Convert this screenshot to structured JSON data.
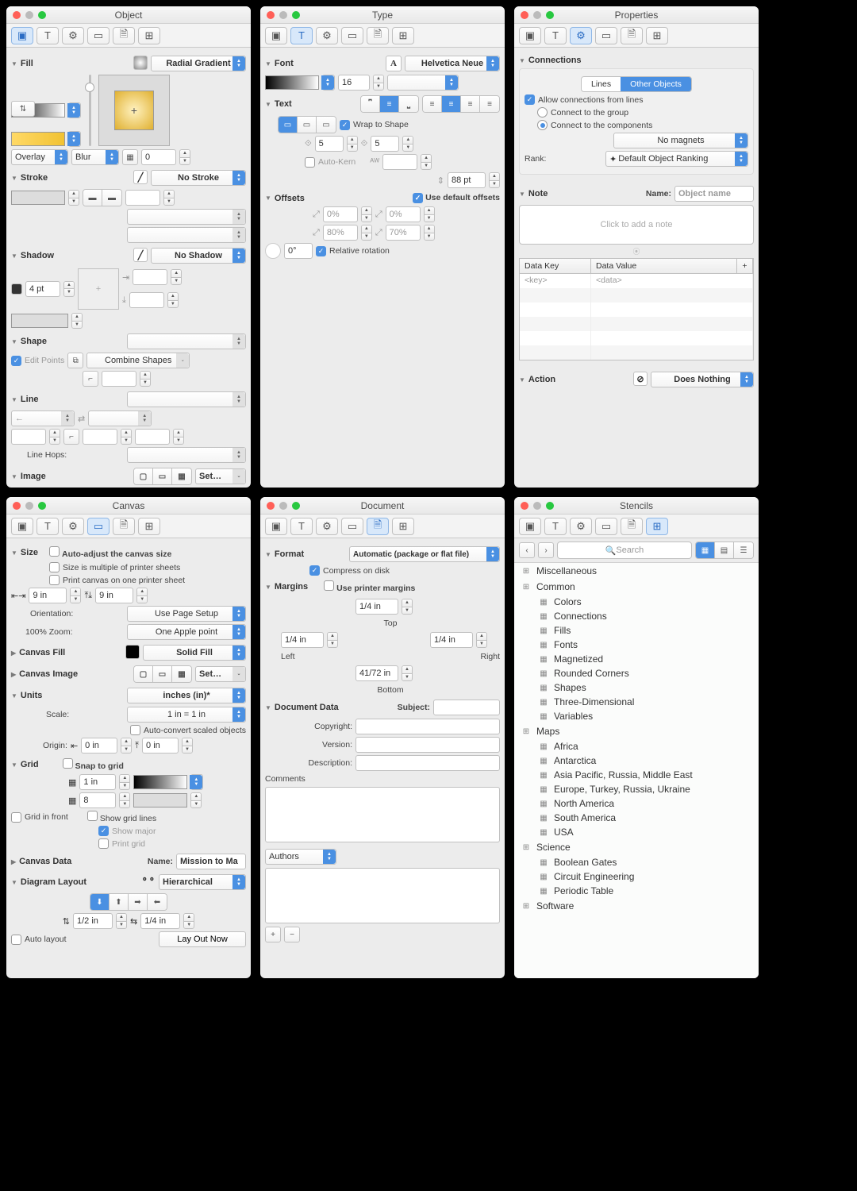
{
  "panels": {
    "object": {
      "title": "Object",
      "fill": {
        "label": "Fill",
        "type": "Radial Gradient",
        "blend": "Overlay",
        "blur": "Blur",
        "blur_val": "0"
      },
      "stroke": {
        "label": "Stroke",
        "type": "No Stroke"
      },
      "shadow": {
        "label": "Shadow",
        "type": "No Shadow",
        "size": "4 pt"
      },
      "shape": {
        "label": "Shape",
        "edit": "Edit Points",
        "combine": "Combine Shapes"
      },
      "line": {
        "label": "Line",
        "hops": "Line Hops:"
      },
      "image": {
        "label": "Image",
        "set": "Set…"
      }
    },
    "type": {
      "title": "Type",
      "font": {
        "label": "Font",
        "family": "Helvetica Neue",
        "size": "16"
      },
      "text": {
        "label": "Text",
        "wrap": "Wrap to Shape",
        "kern": "Auto-Kern",
        "inset1": "5",
        "inset2": "5",
        "lineheight": "88 pt"
      },
      "offsets": {
        "label": "Offsets",
        "default": "Use default offsets",
        "v1": "0%",
        "v2": "0%",
        "v3": "80%",
        "v4": "70%",
        "rot": "0°",
        "relrot": "Relative rotation"
      }
    },
    "properties": {
      "title": "Properties",
      "connections": {
        "label": "Connections",
        "tab1": "Lines",
        "tab2": "Other Objects",
        "allow": "Allow connections from lines",
        "opt1": "Connect to the group",
        "opt2": "Connect to the components",
        "magnets": "No magnets",
        "rank": "Rank:",
        "ranking": "Default Object Ranking"
      },
      "note": {
        "label": "Note",
        "name": "Name:",
        "placeholder": "Object name",
        "noteplaceholder": "Click to add a note",
        "key": "Data Key",
        "value": "Data Value",
        "keyph": "<key>",
        "valph": "<data>"
      },
      "action": {
        "label": "Action",
        "value": "Does Nothing"
      }
    },
    "canvas": {
      "title": "Canvas",
      "size": {
        "label": "Size",
        "auto": "Auto-adjust the canvas size",
        "multiple": "Size is multiple of printer sheets",
        "one": "Print canvas on one printer sheet",
        "w": "9 in",
        "h": "9 in",
        "orient": "Orientation:",
        "orientval": "Use Page Setup",
        "zoom": "100% Zoom:",
        "zoomval": "One Apple point"
      },
      "canvasfill": {
        "label": "Canvas Fill",
        "value": "Solid Fill"
      },
      "canvasimage": {
        "label": "Canvas Image",
        "set": "Set…"
      },
      "units": {
        "label": "Units",
        "value": "inches (in)*",
        "scale": "Scale:",
        "scaleval": "1 in = 1 in",
        "autoconv": "Auto-convert scaled objects",
        "origin": "Origin:",
        "ox": "0 in",
        "oy": "0 in"
      },
      "grid": {
        "label": "Grid",
        "snap": "Snap to grid",
        "spacing": "1 in",
        "sub": "8",
        "front": "Grid in front",
        "show": "Show grid lines",
        "major": "Show major",
        "print": "Print grid"
      },
      "canvasdata": {
        "label": "Canvas Data",
        "name": "Name:",
        "nameval": "Mission to Ma"
      },
      "diagram": {
        "label": "Diagram Layout",
        "value": "Hierarchical",
        "v1": "1/2 in",
        "v2": "1/4 in",
        "auto": "Auto layout",
        "btn": "Lay Out Now"
      }
    },
    "document": {
      "title": "Document",
      "format": {
        "label": "Format",
        "value": "Automatic (package or flat file)",
        "compress": "Compress on disk"
      },
      "margins": {
        "label": "Margins",
        "printer": "Use printer margins",
        "top": "1/4 in",
        "toplabel": "Top",
        "left": "1/4 in",
        "leftlabel": "Left",
        "right": "1/4 in",
        "rightlabel": "Right",
        "bottom": "41/72 in",
        "bottomlabel": "Bottom"
      },
      "docdata": {
        "label": "Document Data",
        "subject": "Subject:",
        "copyright": "Copyright:",
        "version": "Version:",
        "description": "Description:",
        "comments": "Comments",
        "authors": "Authors"
      }
    },
    "stencils": {
      "title": "Stencils",
      "search": "Search",
      "categories": [
        {
          "name": "Miscellaneous",
          "items": []
        },
        {
          "name": "Common",
          "items": [
            "Colors",
            "Connections",
            "Fills",
            "Fonts",
            "Magnetized",
            "Rounded Corners",
            "Shapes",
            "Three-Dimensional",
            "Variables"
          ]
        },
        {
          "name": "Maps",
          "items": [
            "Africa",
            "Antarctica",
            "Asia Pacific, Russia, Middle East",
            "Europe, Turkey, Russia, Ukraine",
            "North America",
            "South America",
            "USA"
          ]
        },
        {
          "name": "Science",
          "items": [
            "Boolean Gates",
            "Circuit Engineering",
            "Periodic Table"
          ]
        },
        {
          "name": "Software",
          "items": []
        }
      ]
    }
  }
}
